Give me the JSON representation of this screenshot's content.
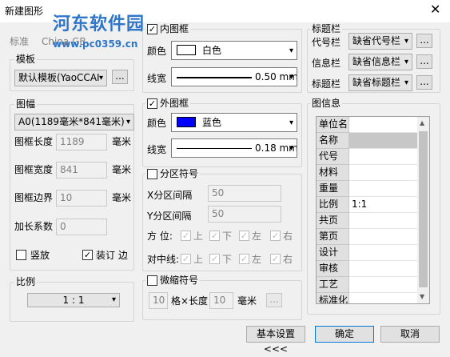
{
  "window": {
    "title": "新建图形",
    "close_glyph": "✕"
  },
  "watermark": {
    "text": "河东软件园",
    "url": "www.pc0359.cn"
  },
  "standard": {
    "label": "标准",
    "value": "China GB"
  },
  "template": {
    "legend": "模板",
    "value": "默认模板(YaoCCAI",
    "more": "..."
  },
  "sheet": {
    "legend": "图幅",
    "size_value": "A0(1189毫米*841毫米)",
    "length_label": "图框长度",
    "length_value": "1189",
    "length_unit": "毫米",
    "width_label": "图框宽度",
    "width_value": "841",
    "width_unit": "毫米",
    "margin_label": "图框边界",
    "margin_value": "10",
    "margin_unit": "毫米",
    "extend_label": "加长系数",
    "extend_value": "0",
    "portrait_label": "竖放",
    "portrait_checked": false,
    "binding_label": "装订 边",
    "binding_checked": true
  },
  "scale": {
    "legend": "比例",
    "value": "1 : 1"
  },
  "inner_frame": {
    "label": "内图框",
    "checked": true,
    "color_label": "颜色",
    "color_name": "白色",
    "color_hex": "#ffffff",
    "width_label": "线宽",
    "width_value": "0.50 mm"
  },
  "outer_frame": {
    "label": "外图框",
    "checked": true,
    "color_label": "颜色",
    "color_name": "蓝色",
    "color_hex": "#0000ff",
    "width_label": "线宽",
    "width_value": "0.18 mm"
  },
  "zone": {
    "label": "分区符号",
    "checked": false,
    "x_label": "X分区间隔",
    "x_value": "50",
    "y_label": "Y分区间隔",
    "y_value": "50",
    "dir_label": "方  位:",
    "center_label": "对中线:",
    "opts": [
      "上",
      "下",
      "左",
      "右"
    ]
  },
  "micro": {
    "label": "微缩符号",
    "checked": false,
    "count": "10",
    "mid_label": "格×长度",
    "length": "10",
    "unit": "毫米",
    "more": "..."
  },
  "title_bar": {
    "legend": "标题栏",
    "code_label": "代号栏",
    "code_value": "缺省代号栏",
    "info_label": "信息栏",
    "info_value": "缺省信息栏",
    "title_label": "标题栏",
    "title_value": "缺省标题栏",
    "more": "..."
  },
  "drawing_info": {
    "legend": "图信息",
    "rows": [
      {
        "key": "单位名",
        "value": ""
      },
      {
        "key": "名称",
        "value": ""
      },
      {
        "key": "代号",
        "value": ""
      },
      {
        "key": "材料",
        "value": ""
      },
      {
        "key": "重量",
        "value": ""
      },
      {
        "key": "比例",
        "value": "1:1"
      },
      {
        "key": "共页",
        "value": ""
      },
      {
        "key": "第页",
        "value": ""
      },
      {
        "key": "设计",
        "value": ""
      },
      {
        "key": "审核",
        "value": ""
      },
      {
        "key": "工艺",
        "value": ""
      },
      {
        "key": "标准化",
        "value": ""
      }
    ]
  },
  "buttons": {
    "basic": "基本设置<<<",
    "ok": "确定",
    "cancel": "取消"
  }
}
